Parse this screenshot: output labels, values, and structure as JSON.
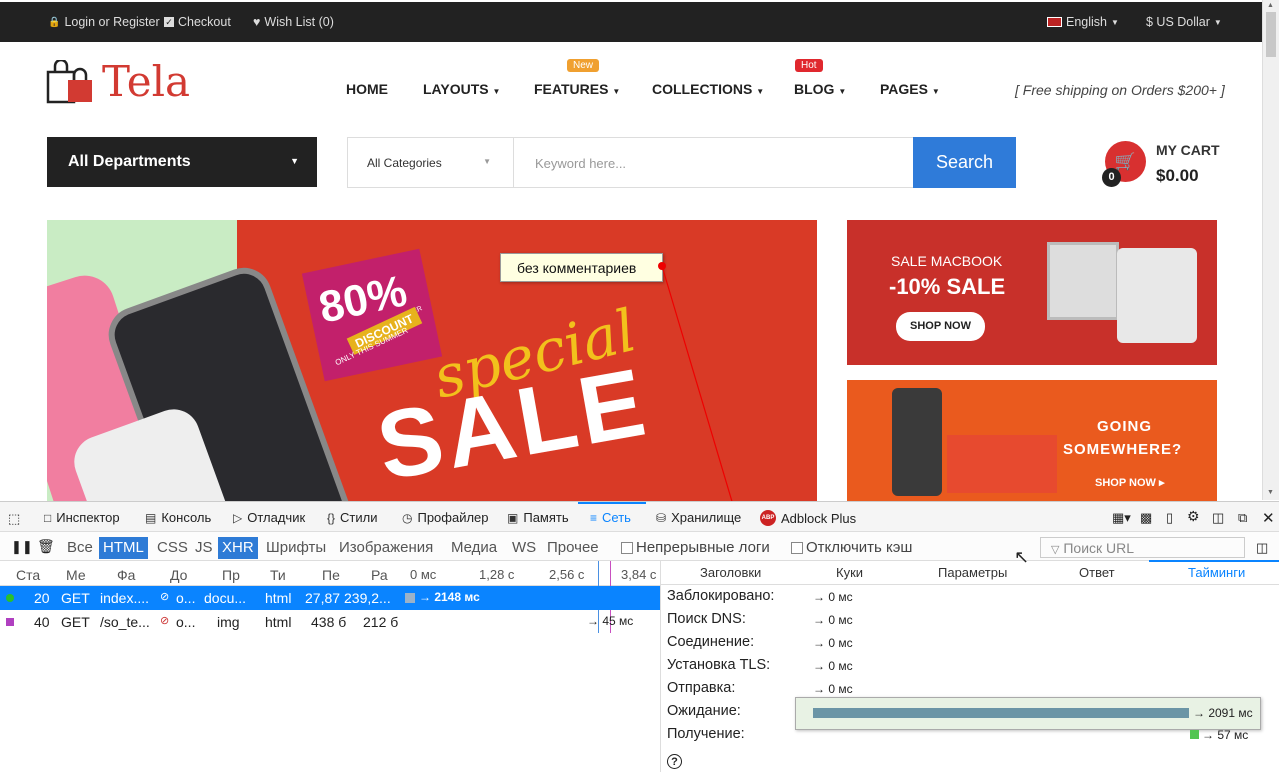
{
  "topbar": {
    "login": "Login or Register",
    "checkout": "Checkout",
    "wishlist": "Wish List (0)",
    "language": "English",
    "currency": "$ US Dollar"
  },
  "logo": {
    "text": "Tela"
  },
  "nav": {
    "home": "HOME",
    "layouts": "LAYOUTS",
    "features": "FEATURES",
    "features_badge": "New",
    "collections": "COLLECTIONS",
    "blog": "BLOG",
    "blog_badge": "Hot",
    "pages": "PAGES"
  },
  "promo": "[ Free shipping on Orders $200+ ]",
  "departments": "All Departments",
  "search": {
    "category": "All Categories",
    "placeholder": "Keyword here...",
    "button": "Search"
  },
  "cart": {
    "label": "MY CART",
    "total": "$0.00",
    "count": "0"
  },
  "hero": {
    "badge_percent": "80%",
    "badge_super": "SUPER",
    "badge_discount": "DISCOUNT",
    "badge_sub": "ONLY THIS SUMMER",
    "script": "special",
    "headline": "SALE"
  },
  "tooltip": "без комментариев",
  "banner1": {
    "title": "SALE MACBOOK",
    "sub": "-10% SALE",
    "button": "SHOP NOW"
  },
  "banner2": {
    "title1": "GOING",
    "title2": "SOMEWHERE?",
    "button": "SHOP NOW"
  },
  "devtools": {
    "tabs": [
      "Инспектор",
      "Консоль",
      "Отладчик",
      "Стили",
      "Профайлер",
      "Память",
      "Сеть",
      "Хранилище",
      "Adblock Plus"
    ],
    "filters": [
      "Все",
      "HTML",
      "CSS",
      "JS",
      "XHR",
      "Шрифты",
      "Изображения",
      "Медиа",
      "WS",
      "Прочее"
    ],
    "persist_logs": "Непрерывные логи",
    "disable_cache": "Отключить кэш",
    "url_placeholder": "Поиск URL",
    "columns": [
      "Ста",
      "Ме",
      "Фа",
      "До",
      "Пр",
      "Ти",
      "Пе",
      "Ра"
    ],
    "timeline_ticks": [
      "0 мс",
      "1,28 с",
      "2,56 с",
      "3,84 с"
    ],
    "rows": [
      {
        "status": "20",
        "method": "GET",
        "file": "index....",
        "domain": "o...",
        "cause": "docu...",
        "type": "html",
        "transferred": "27,87 ...",
        "size": "239,2...",
        "time": "→ 2148 мс"
      },
      {
        "status": "40",
        "method": "GET",
        "file": "/so_te...",
        "domain": "o...",
        "cause": "img",
        "type": "html",
        "transferred": "438 б",
        "size": "212 б",
        "time": "→ 45 мс"
      }
    ],
    "detail_tabs": [
      "Заголовки",
      "Куки",
      "Параметры",
      "Ответ",
      "Тайминги"
    ],
    "timings": [
      {
        "label": "Заблокировано:",
        "value": "→ 0 мс"
      },
      {
        "label": "Поиск DNS:",
        "value": "→ 0 мс"
      },
      {
        "label": "Соединение:",
        "value": "→ 0 мс"
      },
      {
        "label": "Установка TLS:",
        "value": "→ 0 мс"
      },
      {
        "label": "Отправка:",
        "value": "→ 0 мс"
      },
      {
        "label": "Ожидание:",
        "value": "→ 2091 мс"
      },
      {
        "label": "Получение:",
        "value": "→ 57 мс"
      }
    ]
  }
}
